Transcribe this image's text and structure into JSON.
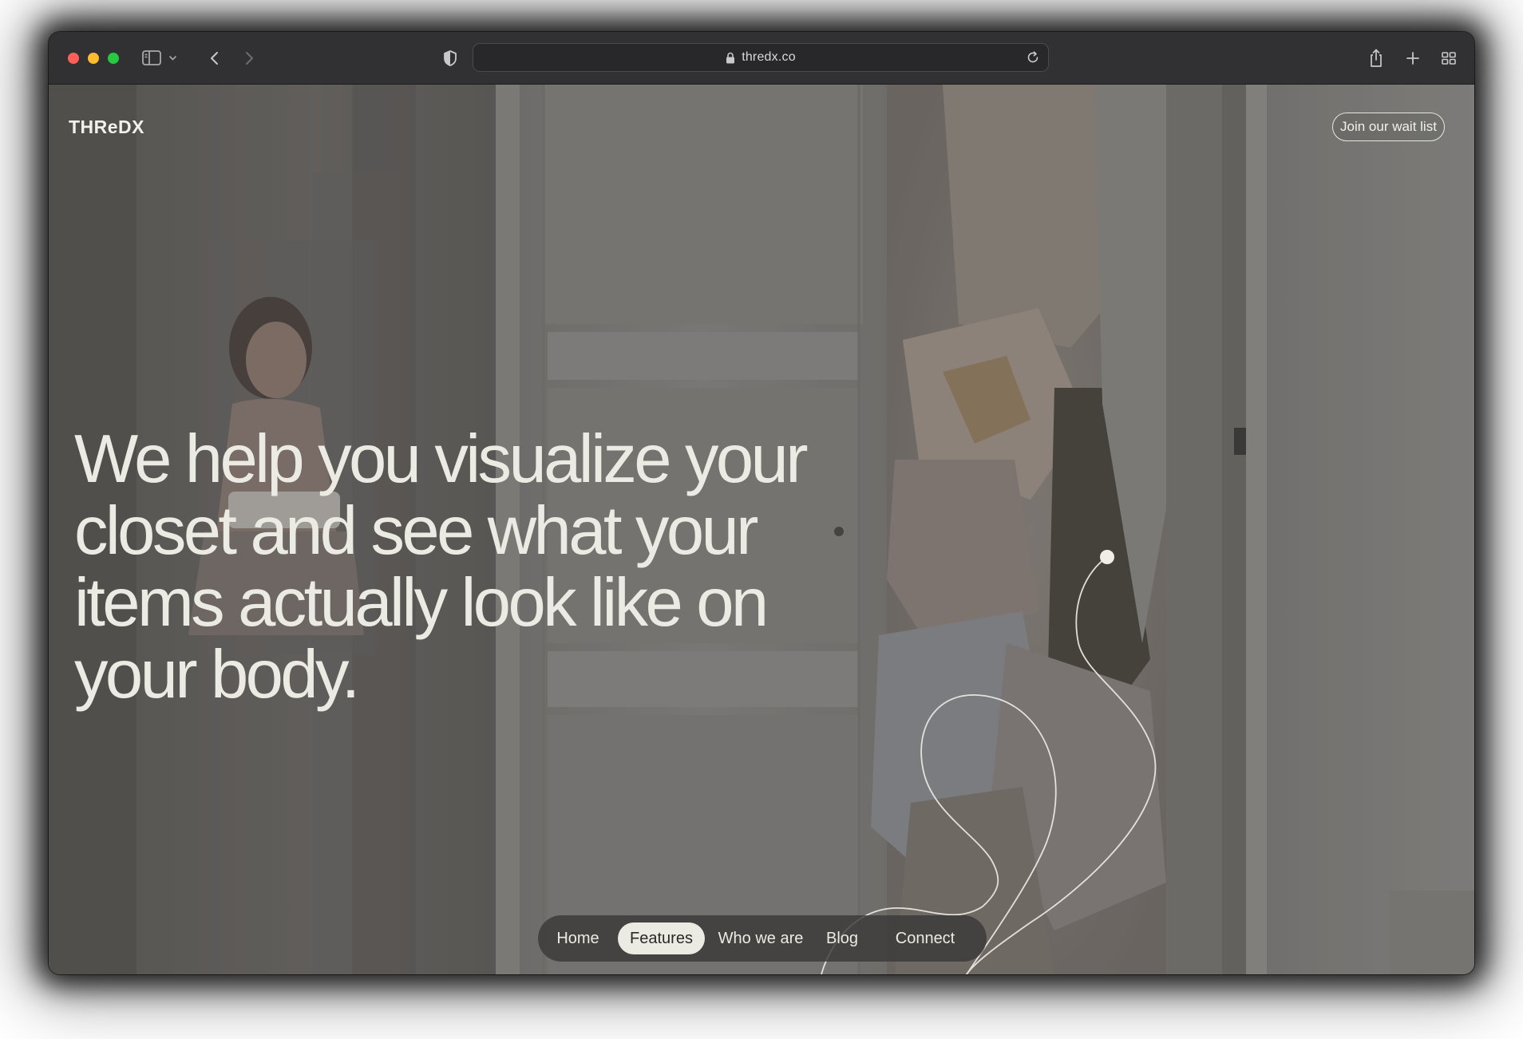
{
  "browser": {
    "url": "thredx.co",
    "buttons": {
      "sidebar": "sidebar-toggle",
      "back": "back",
      "forward": "forward",
      "share": "share",
      "new_tab": "new-tab",
      "tabs": "tab-overview"
    }
  },
  "site": {
    "logo": "THReDX",
    "cta_label": "Join our wait list",
    "headline": "We help you visualize your closet and see what your items actually look like on your body.",
    "nav": [
      {
        "label": "Home",
        "active": false
      },
      {
        "label": "Features",
        "active": true
      },
      {
        "label": "Who we are",
        "active": false
      },
      {
        "label": "Blog",
        "active": false
      },
      {
        "label": "Connect",
        "active": false
      }
    ]
  },
  "colors": {
    "traffic_red": "#fe5f57",
    "traffic_yellow": "#febc2e",
    "traffic_green": "#28c840",
    "toolbar": "#313133",
    "text_light": "#ecebe3",
    "nav_bg": "#3a3938"
  }
}
